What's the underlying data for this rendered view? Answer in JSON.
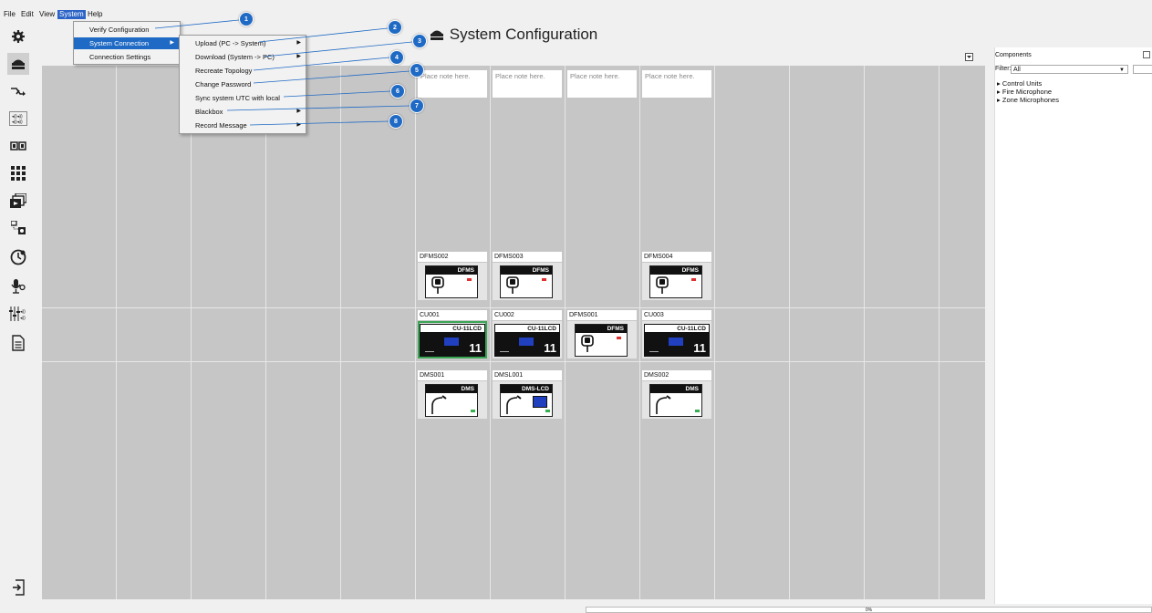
{
  "menubar": {
    "items": [
      "File",
      "Edit",
      "View",
      "System",
      "Help"
    ]
  },
  "sidebar": {
    "icons": [
      "gear-icon",
      "system-config-icon",
      "routing-icon",
      "audio-matrix-icon",
      "io-icon",
      "keypad-icon",
      "media-icon",
      "network-icon",
      "clock-icon",
      "microphone-icon",
      "mixer-icon",
      "document-icon"
    ],
    "bottom_icon": "logout-icon"
  },
  "title": {
    "text": "System Configuration",
    "icon": "system-config-icon"
  },
  "system_menu": {
    "items": [
      {
        "label": "Verify Configuration",
        "submenu": false
      },
      {
        "label": "System Connection",
        "submenu": true
      },
      {
        "label": "Connection Settings",
        "submenu": false
      }
    ],
    "highlighted": "System Connection"
  },
  "connection_submenu": {
    "items": [
      {
        "label": "Upload (PC -> System)",
        "submenu": true
      },
      {
        "label": "Download (System -> PC)",
        "submenu": true
      },
      {
        "label": "Recreate Topology",
        "submenu": false
      },
      {
        "label": "Change Password",
        "submenu": false
      },
      {
        "label": "Sync system UTC with local",
        "submenu": false
      },
      {
        "label": "Blackbox",
        "submenu": true
      },
      {
        "label": "Record Message",
        "submenu": true
      }
    ]
  },
  "callouts": [
    "1",
    "2",
    "3",
    "4",
    "5",
    "6",
    "7",
    "8"
  ],
  "notes": [
    "Place note here.",
    "Place note here.",
    "Place note here.",
    "Place note here."
  ],
  "devices": {
    "row1": [
      {
        "name": "DFMS002",
        "model": "DFMS",
        "type": "fire-mic"
      },
      {
        "name": "DFMS003",
        "model": "DFMS",
        "type": "fire-mic"
      },
      {
        "name": "DFMS004",
        "model": "DFMS",
        "type": "fire-mic"
      }
    ],
    "row2": [
      {
        "name": "CU001",
        "model": "CU-11LCD",
        "type": "control-unit",
        "number": "11"
      },
      {
        "name": "CU002",
        "model": "CU-11LCD",
        "type": "control-unit",
        "number": "11"
      },
      {
        "name": "DFMS001",
        "model": "DFMS",
        "type": "fire-mic"
      },
      {
        "name": "CU003",
        "model": "CU-11LCD",
        "type": "control-unit",
        "number": "11"
      }
    ],
    "row3": [
      {
        "name": "DMS001",
        "model": "DMS",
        "type": "zone-mic"
      },
      {
        "name": "DMSL001",
        "model": "DMS-LCD",
        "type": "zone-mic-lcd"
      },
      {
        "name": "DMS002",
        "model": "DMS",
        "type": "zone-mic"
      }
    ]
  },
  "components_panel": {
    "title": "Components",
    "filter_label": "Filter:",
    "filter_value": "All",
    "tree": [
      "Control Units",
      "Fire Microphone",
      "Zone Microphones"
    ]
  },
  "status_bar": {
    "text": "0%"
  },
  "colors": {
    "menu_highlight": "#1f6ac4",
    "callout": "#1f6ac4",
    "selected_outline": "#3aa655",
    "canvas": "#c6c6c6"
  }
}
